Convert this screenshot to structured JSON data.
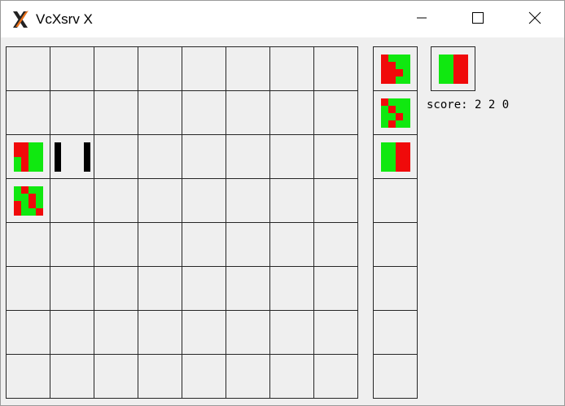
{
  "window": {
    "title": "VcXsrv X",
    "icon": "x-logo-icon",
    "controls": [
      "minimize-icon",
      "maximize-icon",
      "close-icon"
    ]
  },
  "game": {
    "score_label": "score: 2 2 0",
    "colors": {
      "red": "#f00a0a",
      "green": "#10e810",
      "empty": "#efefef",
      "grid": "#262626",
      "wall": "#000000"
    },
    "board": {
      "rows": 8,
      "cols": 8,
      "contents": [
        {
          "row": 2,
          "col": 0,
          "type": "piece",
          "pattern": [
            [
              "R",
              "R",
              "G",
              "G"
            ],
            [
              "R",
              "R",
              "G",
              "G"
            ],
            [
              "G",
              "R",
              "G",
              "G"
            ],
            [
              "G",
              "R",
              "G",
              "G"
            ]
          ]
        },
        {
          "row": 2,
          "col": 1,
          "type": "walls",
          "pattern": "two-black-bars"
        },
        {
          "row": 3,
          "col": 0,
          "type": "piece",
          "pattern": [
            [
              "G",
              "R",
              "G",
              "G"
            ],
            [
              "G",
              "G",
              "R",
              "G"
            ],
            [
              "R",
              "G",
              "R",
              "G"
            ],
            [
              "R",
              "G",
              "G",
              "R"
            ]
          ]
        }
      ]
    },
    "queue": {
      "rows": 8,
      "contents": [
        {
          "row": 0,
          "type": "piece",
          "pattern": [
            [
              "R",
              "G",
              "G",
              "G"
            ],
            [
              "R",
              "R",
              "G",
              "G"
            ],
            [
              "R",
              "R",
              "R",
              "G"
            ],
            [
              "R",
              "R",
              "G",
              "G"
            ]
          ]
        },
        {
          "row": 1,
          "type": "piece",
          "pattern": [
            [
              "R",
              "G",
              "G",
              "G"
            ],
            [
              "G",
              "R",
              "G",
              "G"
            ],
            [
              "G",
              "G",
              "R",
              "G"
            ],
            [
              "G",
              "R",
              "G",
              "G"
            ]
          ]
        },
        {
          "row": 2,
          "type": "piece",
          "pattern": [
            [
              "G",
              "G",
              "R",
              "R"
            ],
            [
              "G",
              "G",
              "R",
              "R"
            ],
            [
              "G",
              "G",
              "R",
              "R"
            ],
            [
              "G",
              "G",
              "R",
              "R"
            ]
          ]
        }
      ]
    },
    "current": {
      "type": "piece",
      "pattern": [
        [
          "G",
          "G",
          "R",
          "R"
        ],
        [
          "G",
          "G",
          "R",
          "R"
        ],
        [
          "G",
          "G",
          "R",
          "R"
        ],
        [
          "G",
          "G",
          "R",
          "R"
        ]
      ]
    }
  }
}
